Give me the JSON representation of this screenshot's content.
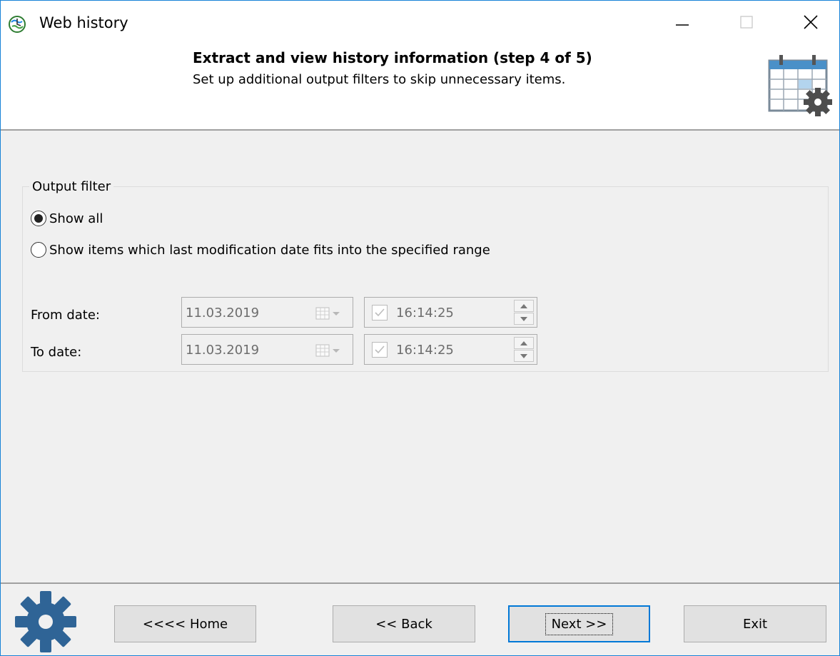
{
  "window": {
    "title": "Web history",
    "app_icon": "globe-history-icon"
  },
  "header": {
    "title": "Extract and view history information (step 4 of 5)",
    "subtitle": "Set up additional output filters to skip unnecessary items.",
    "icon": "calendar-gear-icon"
  },
  "filter": {
    "group_label": "Output filter",
    "options": [
      {
        "label": "Show all",
        "selected": true
      },
      {
        "label": "Show items which last modification date fits into the specified range",
        "selected": false
      }
    ],
    "from": {
      "label": "From date:",
      "date": "11.03.2019",
      "time": "16:14:25",
      "time_checked": true
    },
    "to": {
      "label": "To date:",
      "date": "11.03.2019",
      "time": "16:14:25",
      "time_checked": true
    }
  },
  "footer": {
    "icon": "gear-icon",
    "buttons": {
      "home": {
        "label": "<<<< Home"
      },
      "back": {
        "label": "<< Back"
      },
      "next": {
        "label": "Next >>",
        "default": true
      },
      "exit": {
        "label": "Exit"
      }
    }
  },
  "colors": {
    "accent": "#0078d7",
    "window_border": "#1883d7",
    "gear_blue": "#2f6496"
  }
}
